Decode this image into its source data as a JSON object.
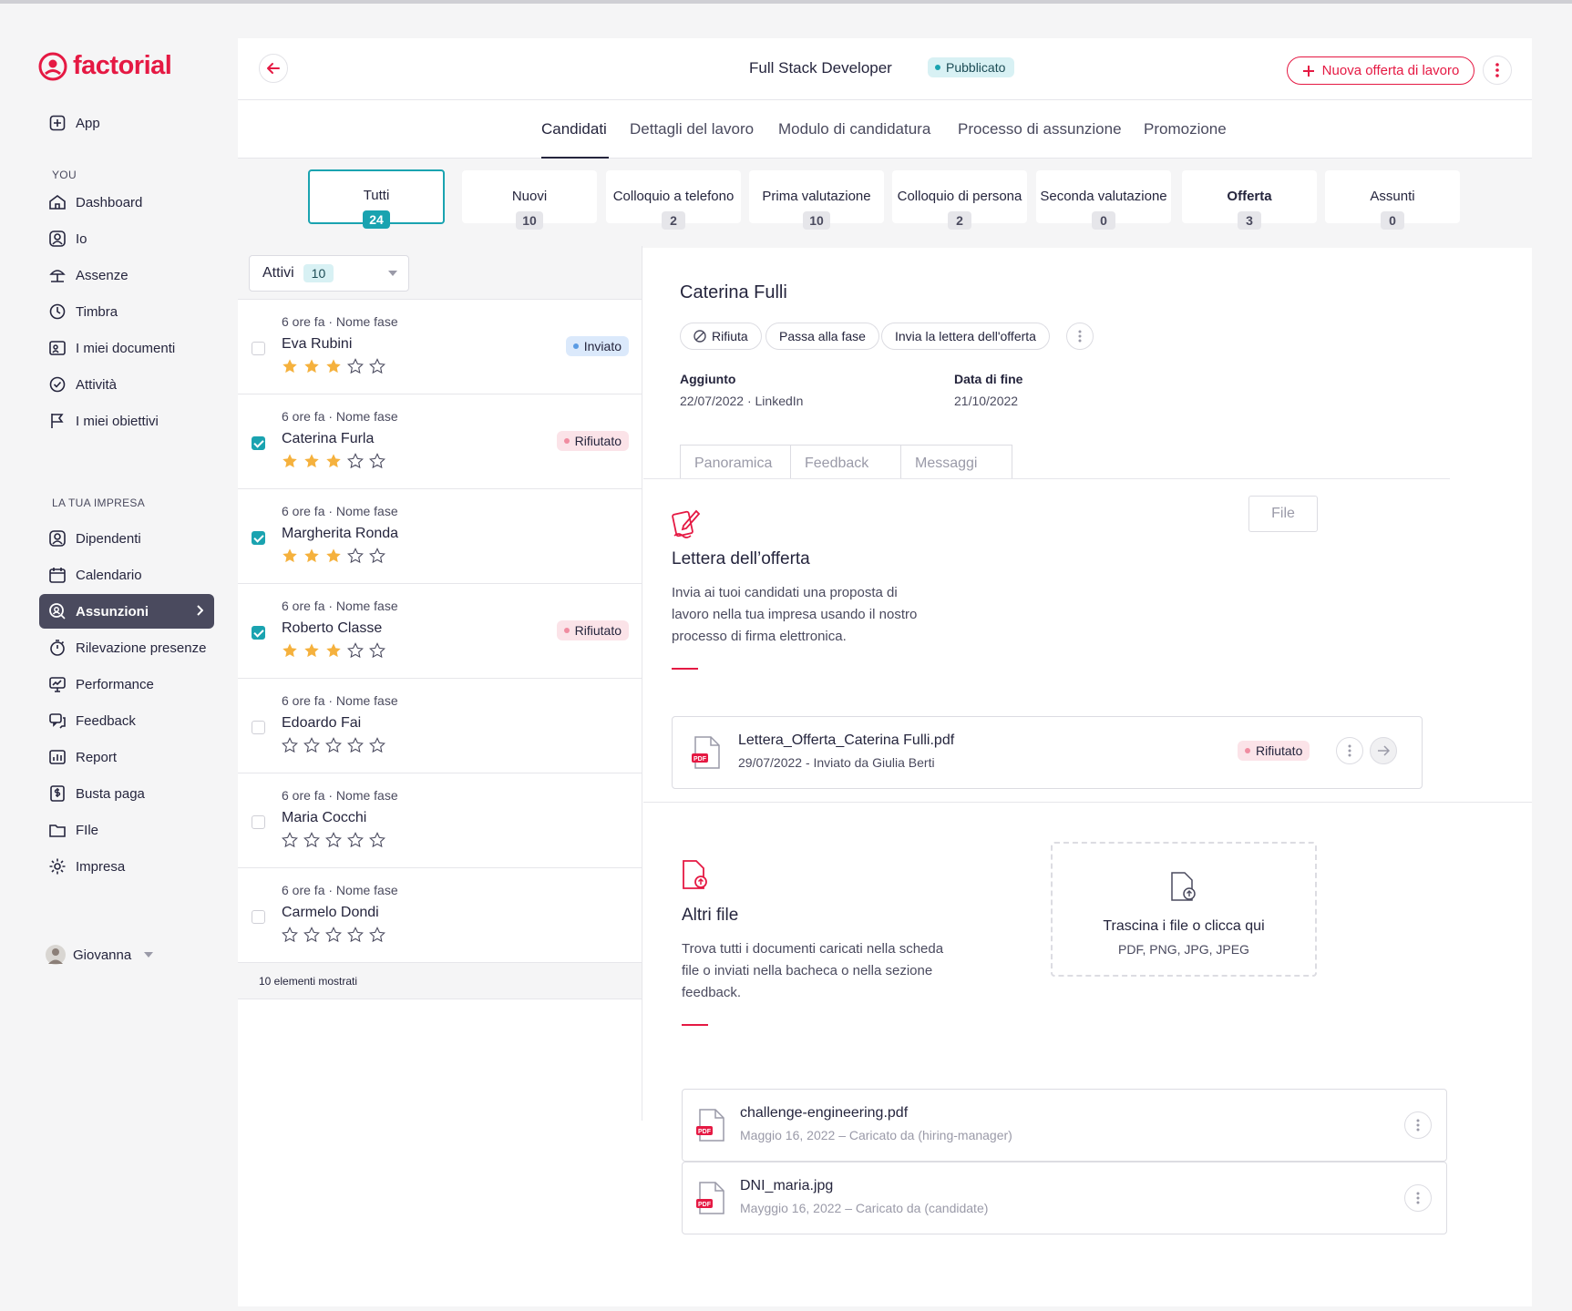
{
  "app": {
    "brand": "factorial",
    "accent": "#e51943",
    "teal": "#1aa3b0"
  },
  "sidebar": {
    "app_label": "App",
    "you_label": "YOU",
    "company_label": "LA TUA IMPRESA",
    "you_items": [
      {
        "label": "Dashboard",
        "icon": "home-icon"
      },
      {
        "label": "Io",
        "icon": "user-icon"
      },
      {
        "label": "Assenze",
        "icon": "beach-icon"
      },
      {
        "label": "Timbra",
        "icon": "clock-icon"
      },
      {
        "label": "I miei documenti",
        "icon": "document-icon"
      },
      {
        "label": "Attività",
        "icon": "check-circle-icon"
      },
      {
        "label": "I miei obiettivi",
        "icon": "flag-icon"
      }
    ],
    "company_items": [
      {
        "label": "Dipendenti",
        "icon": "people-icon"
      },
      {
        "label": "Calendario",
        "icon": "calendar-icon"
      },
      {
        "label": "Assunzioni",
        "icon": "search-person-icon",
        "active": true
      },
      {
        "label": "Rilevazione presenze",
        "icon": "stopwatch-icon"
      },
      {
        "label": "Performance",
        "icon": "performance-icon"
      },
      {
        "label": "Feedback",
        "icon": "chat-icon"
      },
      {
        "label": "Report",
        "icon": "chart-icon"
      },
      {
        "label": "Busta paga",
        "icon": "money-icon"
      },
      {
        "label": "FIle",
        "icon": "folder-icon"
      },
      {
        "label": "Impresa",
        "icon": "gear-icon"
      }
    ],
    "user_name": "Giovanna"
  },
  "header": {
    "job_title": "Full Stack Developer",
    "status": "Pubblicato",
    "new_offer": "Nuova offerta di lavoro"
  },
  "tabs": [
    "Candidati",
    "Dettagli del lavoro",
    "Modulo di candidatura",
    "Processo di assunzione",
    "Promozione"
  ],
  "stages": [
    {
      "label": "Tutti",
      "count": "24"
    },
    {
      "label": "Nuovi",
      "count": "10"
    },
    {
      "label": "Colloquio a telefono",
      "count": "2"
    },
    {
      "label": "Prima valutazione",
      "count": "10"
    },
    {
      "label": "Colloquio di persona",
      "count": "2"
    },
    {
      "label": "Seconda valutazione",
      "count": "0"
    },
    {
      "label": "Offerta",
      "count": "3"
    },
    {
      "label": "Assunti",
      "count": "0"
    }
  ],
  "list": {
    "filter_label": "Attivi",
    "filter_count": "10",
    "footer": "10 elementi mostrati",
    "candidates": [
      {
        "meta": "6 ore fa · Nome fase",
        "name": "Eva Rubini",
        "checked": false,
        "stars": 3,
        "status": "Inviato",
        "status_kind": "inv"
      },
      {
        "meta": "6 ore fa · Nome fase",
        "name": "Caterina Furla",
        "checked": true,
        "stars": 3,
        "status": "Rifiutato",
        "status_kind": "rej"
      },
      {
        "meta": "6 ore fa · Nome fase",
        "name": "Margherita Ronda",
        "checked": true,
        "stars": 3,
        "status": "",
        "status_kind": ""
      },
      {
        "meta": "6 ore fa · Nome fase",
        "name": "Roberto Classe",
        "checked": true,
        "stars": 3,
        "status": "Rifiutato",
        "status_kind": "rej"
      },
      {
        "meta": "6 ore fa · Nome fase",
        "name": "Edoardo Fai",
        "checked": false,
        "stars": 0,
        "status": "",
        "status_kind": ""
      },
      {
        "meta": "6 ore fa · Nome fase",
        "name": "Maria Cocchi",
        "checked": false,
        "stars": 0,
        "status": "",
        "status_kind": ""
      },
      {
        "meta": "6 ore fa · Nome fase",
        "name": "Carmelo Dondi",
        "checked": false,
        "stars": 0,
        "status": "",
        "status_kind": ""
      }
    ]
  },
  "detail": {
    "candidate_name": "Caterina Fulli",
    "actions": {
      "reject": "Rifiuta",
      "next_stage": "Passa alla fase",
      "send_offer": "Invia la lettera dell'offerta"
    },
    "added_label": "Aggiunto",
    "added_value": "22/07/2022 · LinkedIn",
    "end_label": "Data di fine",
    "end_value": "21/10/2022",
    "sub_tabs": [
      "Panoramica",
      "Feedback",
      "Messaggi"
    ],
    "file_button": "File",
    "offer": {
      "title": "Lettera dell’offerta",
      "desc": "Invia ai tuoi candidati una proposta di lavoro nella tua impresa usando il nostro processo di firma elettronica.",
      "file_name": "Lettera_Offerta_Caterina Fulli.pdf",
      "file_sub": "29/07/2022 - Inviato da Giulia Berti",
      "file_status": "Rifiutato"
    },
    "other": {
      "title": "Altri file",
      "desc": "Trova tutti i documenti caricati nella scheda file o inviati nella bacheca o nella sezione feedback.",
      "drop_title": "Trascina i file o clicca qui",
      "drop_sub": "PDF, PNG, JPG, JPEG",
      "files": [
        {
          "name": "challenge-engineering.pdf",
          "sub": "Maggio 16, 2022 – Caricato da (hiring-manager)"
        },
        {
          "name": "DNI_maria.jpg",
          "sub": "Mayggio 16, 2022 – Caricato da (candidate)"
        }
      ]
    }
  }
}
